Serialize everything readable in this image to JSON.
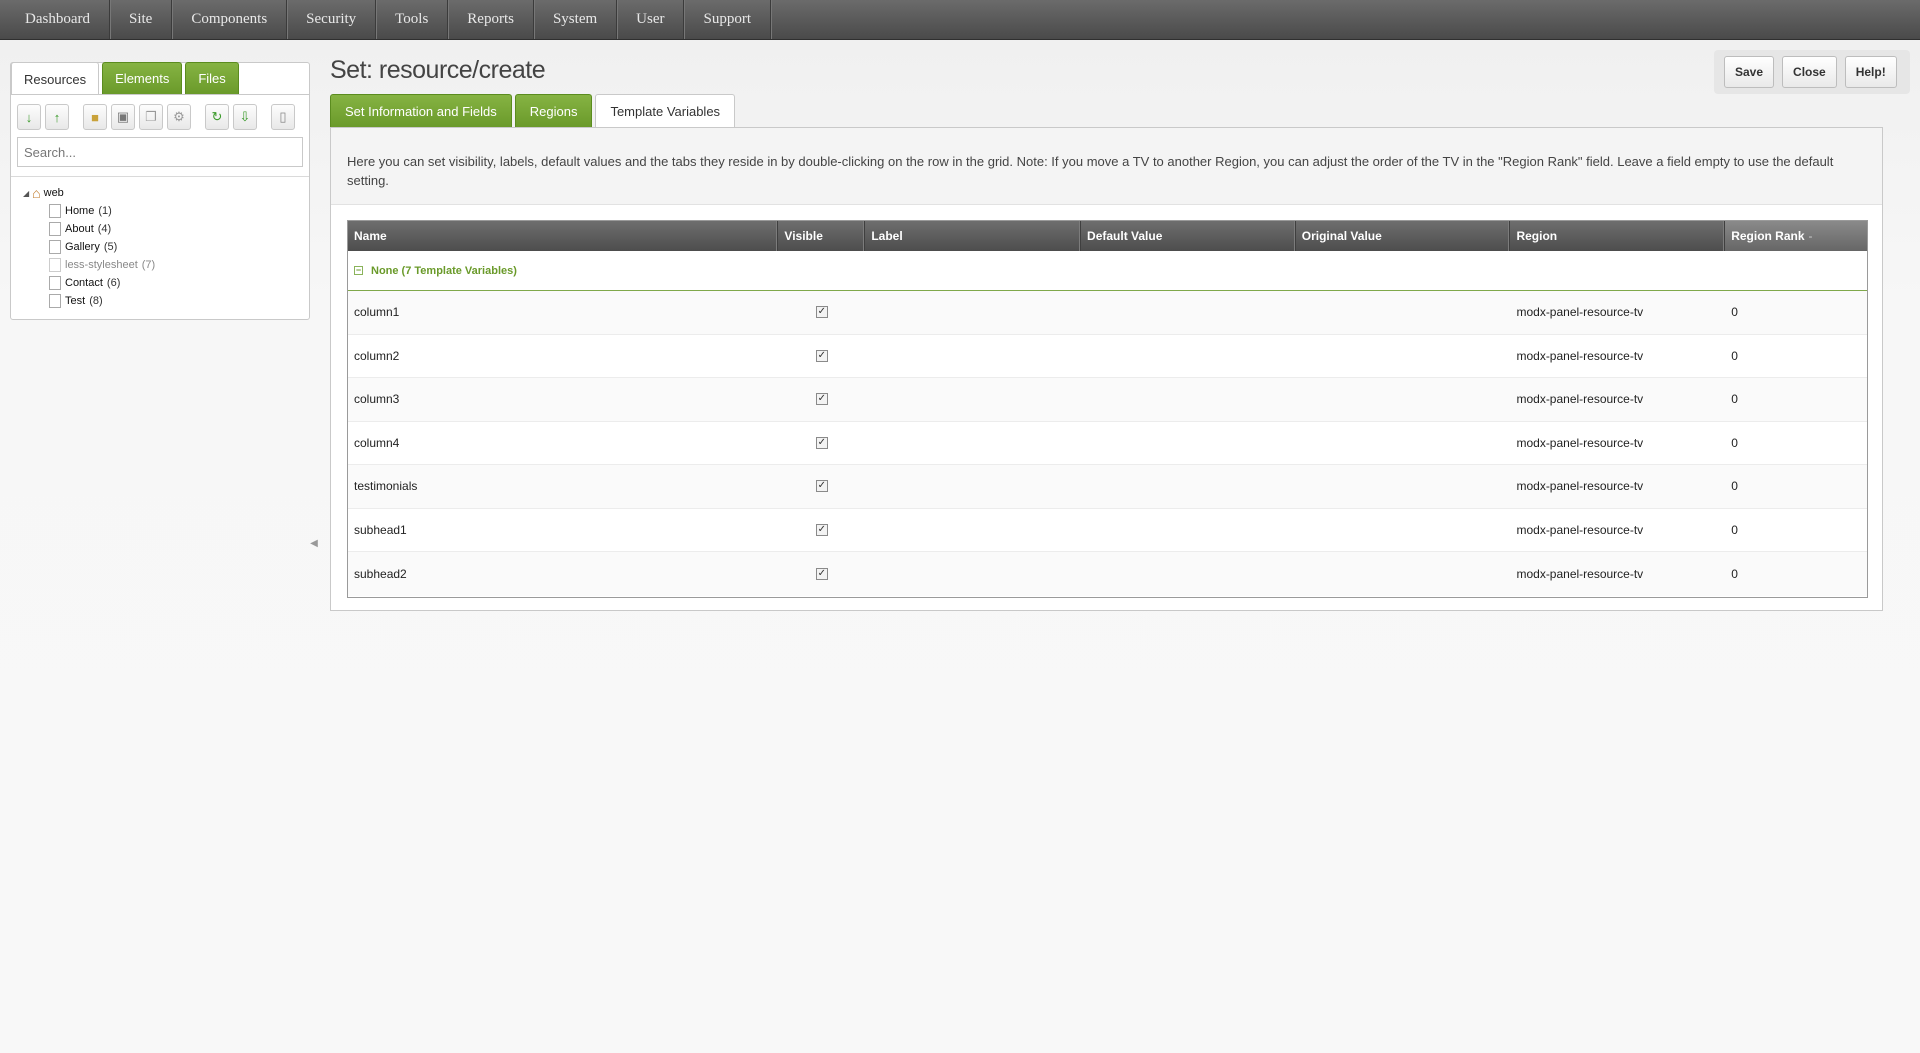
{
  "nav": [
    "Dashboard",
    "Site",
    "Components",
    "Security",
    "Tools",
    "Reports",
    "System",
    "User",
    "Support"
  ],
  "left": {
    "tabs": [
      "Resources",
      "Elements",
      "Files"
    ],
    "search_placeholder": "Search...",
    "tree": {
      "root": "web",
      "items": [
        {
          "name": "Home",
          "id": "(1)"
        },
        {
          "name": "About",
          "id": "(4)"
        },
        {
          "name": "Gallery",
          "id": "(5)"
        },
        {
          "name": "less-stylesheet",
          "id": "(7)"
        },
        {
          "name": "Contact",
          "id": "(6)"
        },
        {
          "name": "Test",
          "id": "(8)"
        }
      ]
    },
    "toolbar_icons": [
      "sort-down-icon",
      "sort-up-icon",
      "new-folder-icon",
      "new-weblink-icon",
      "new-symlink-icon",
      "new-static-icon",
      "refresh-icon",
      "import-icon",
      "trash-icon"
    ]
  },
  "page": {
    "title": "Set: resource/create",
    "actions": {
      "save": "Save",
      "close": "Close",
      "help": "Help!"
    },
    "tabs": [
      "Set Information and Fields",
      "Regions",
      "Template Variables"
    ],
    "description": "Here you can set visibility, labels, default values and the tabs they reside in by double-clicking on the row in the grid. Note: If you move a TV to another Region, you can adjust the order of the TV in the \"Region Rank\" field. Leave a field empty to use the default setting."
  },
  "grid": {
    "columns": [
      "Name",
      "Visible",
      "Label",
      "Default Value",
      "Original Value",
      "Region",
      "Region Rank"
    ],
    "sort_indicator": "-",
    "group": "None (7 Template Variables)",
    "rows": [
      {
        "name": "column1",
        "region": "modx-panel-resource-tv",
        "rank": "0"
      },
      {
        "name": "column2",
        "region": "modx-panel-resource-tv",
        "rank": "0"
      },
      {
        "name": "column3",
        "region": "modx-panel-resource-tv",
        "rank": "0"
      },
      {
        "name": "column4",
        "region": "modx-panel-resource-tv",
        "rank": "0"
      },
      {
        "name": "testimonials",
        "region": "modx-panel-resource-tv",
        "rank": "0"
      },
      {
        "name": "subhead1",
        "region": "modx-panel-resource-tv",
        "rank": "0"
      },
      {
        "name": "subhead2",
        "region": "modx-panel-resource-tv",
        "rank": "0"
      }
    ]
  },
  "colors": {
    "accent_green": "#6a9a2a",
    "nav_bg": "#4a4a4a"
  }
}
